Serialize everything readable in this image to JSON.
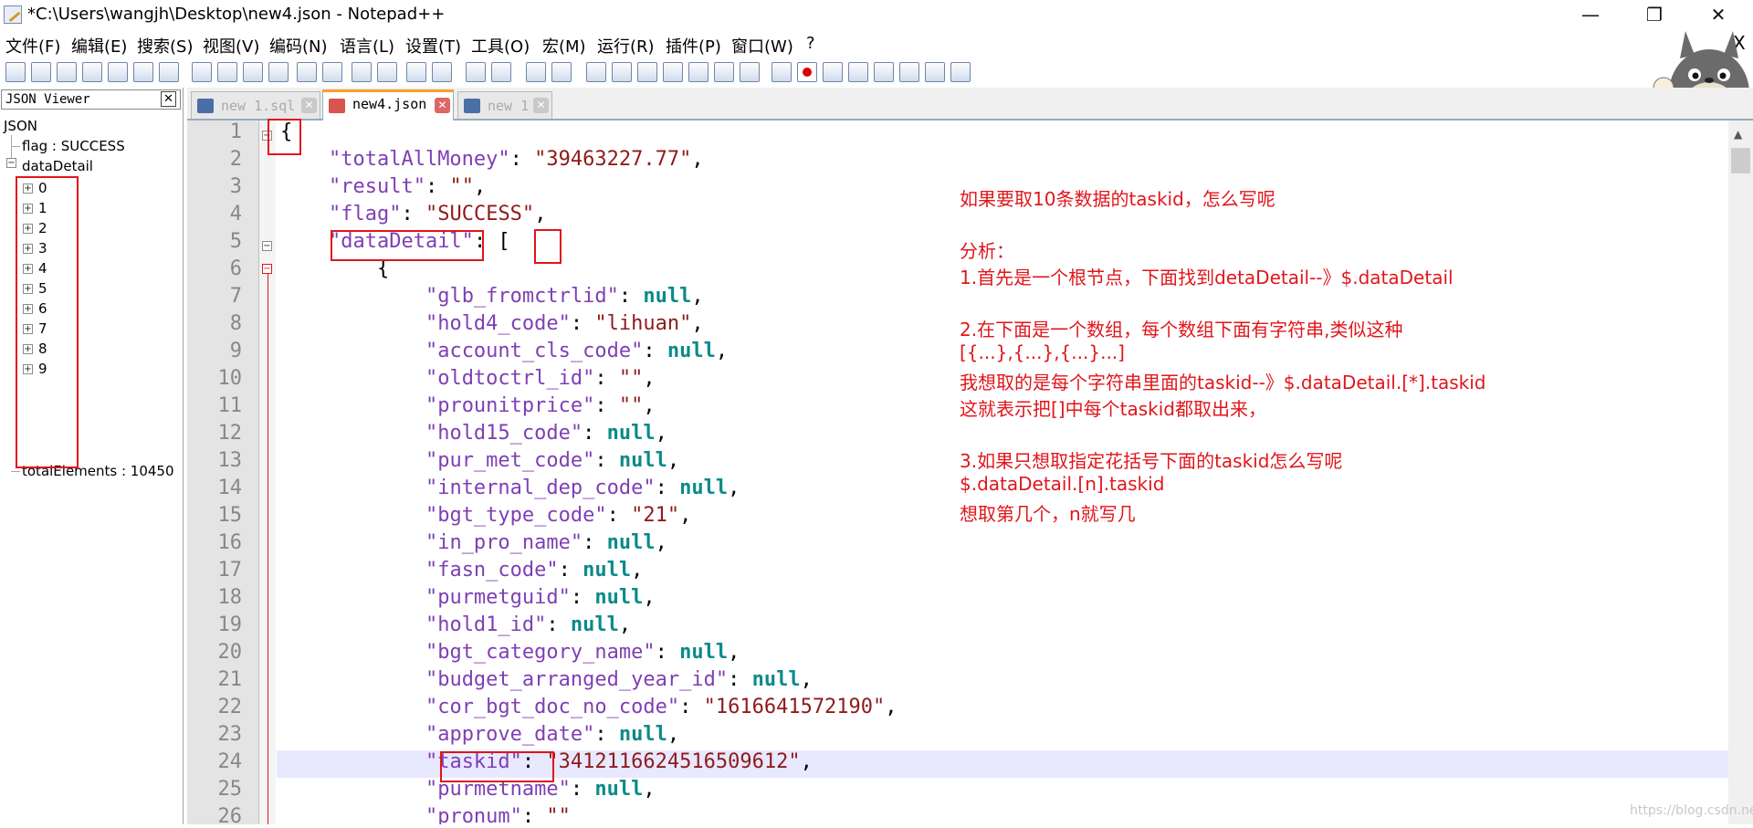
{
  "window": {
    "title": "*C:\\Users\\wangjh\\Desktop\\new4.json - Notepad++",
    "minimize": "—",
    "restore": "❐",
    "close": "✕"
  },
  "menu": {
    "items": [
      "文件(F)",
      "编辑(E)",
      "搜索(S)",
      "视图(V)",
      "编码(N)",
      "语言(L)",
      "设置(T)",
      "工具(O)",
      "宏(M)",
      "运行(R)",
      "插件(P)",
      "窗口(W)",
      "?"
    ],
    "close_doc": "X"
  },
  "panel": {
    "title": "JSON Viewer",
    "close": "✕",
    "root": "JSON",
    "flag": "flag : SUCCESS",
    "dataDetail": "dataDetail",
    "children": [
      "0",
      "1",
      "2",
      "3",
      "4",
      "5",
      "6",
      "7",
      "8",
      "9"
    ],
    "totalElements": "totalElements : 10450"
  },
  "tabs": [
    {
      "label": "new 1.sql",
      "active": false,
      "icon_color": "#4a6fa5"
    },
    {
      "label": "new4.json",
      "active": true,
      "icon_color": "#d9534f"
    },
    {
      "label": "new 1",
      "active": false,
      "icon_color": "#4a6fa5"
    }
  ],
  "editor": {
    "lines": [
      {
        "n": "1",
        "segs": [
          [
            "p",
            "{"
          ]
        ]
      },
      {
        "n": "2",
        "segs": [
          [
            "p",
            "    "
          ],
          [
            "k",
            "\"totalAllMoney\""
          ],
          [
            "p",
            ": "
          ],
          [
            "s",
            "\"39463227.77\""
          ],
          [
            "p",
            ","
          ]
        ]
      },
      {
        "n": "3",
        "segs": [
          [
            "p",
            "    "
          ],
          [
            "k",
            "\"result\""
          ],
          [
            "p",
            ": "
          ],
          [
            "s",
            "\"\""
          ],
          [
            "p",
            ","
          ]
        ]
      },
      {
        "n": "4",
        "segs": [
          [
            "p",
            "    "
          ],
          [
            "k",
            "\"flag\""
          ],
          [
            "p",
            ": "
          ],
          [
            "s",
            "\"SUCCESS\""
          ],
          [
            "p",
            ","
          ]
        ]
      },
      {
        "n": "5",
        "segs": [
          [
            "p",
            "    "
          ],
          [
            "k",
            "\"dataDetail\""
          ],
          [
            "p",
            ": ["
          ]
        ]
      },
      {
        "n": "6",
        "segs": [
          [
            "p",
            "        {"
          ]
        ]
      },
      {
        "n": "7",
        "segs": [
          [
            "p",
            "            "
          ],
          [
            "k",
            "\"glb_fromctrlid\""
          ],
          [
            "p",
            ": "
          ],
          [
            "n",
            "null"
          ],
          [
            "p",
            ","
          ]
        ]
      },
      {
        "n": "8",
        "segs": [
          [
            "p",
            "            "
          ],
          [
            "k",
            "\"hold4_code\""
          ],
          [
            "p",
            ": "
          ],
          [
            "s",
            "\"lihuan\""
          ],
          [
            "p",
            ","
          ]
        ]
      },
      {
        "n": "9",
        "segs": [
          [
            "p",
            "            "
          ],
          [
            "k",
            "\"account_cls_code\""
          ],
          [
            "p",
            ": "
          ],
          [
            "n",
            "null"
          ],
          [
            "p",
            ","
          ]
        ]
      },
      {
        "n": "10",
        "segs": [
          [
            "p",
            "            "
          ],
          [
            "k",
            "\"oldtoctrl_id\""
          ],
          [
            "p",
            ": "
          ],
          [
            "s",
            "\"\""
          ],
          [
            "p",
            ","
          ]
        ]
      },
      {
        "n": "11",
        "segs": [
          [
            "p",
            "            "
          ],
          [
            "k",
            "\"prounitprice\""
          ],
          [
            "p",
            ": "
          ],
          [
            "s",
            "\"\""
          ],
          [
            "p",
            ","
          ]
        ]
      },
      {
        "n": "12",
        "segs": [
          [
            "p",
            "            "
          ],
          [
            "k",
            "\"hold15_code\""
          ],
          [
            "p",
            ": "
          ],
          [
            "n",
            "null"
          ],
          [
            "p",
            ","
          ]
        ]
      },
      {
        "n": "13",
        "segs": [
          [
            "p",
            "            "
          ],
          [
            "k",
            "\"pur_met_code\""
          ],
          [
            "p",
            ": "
          ],
          [
            "n",
            "null"
          ],
          [
            "p",
            ","
          ]
        ]
      },
      {
        "n": "14",
        "segs": [
          [
            "p",
            "            "
          ],
          [
            "k",
            "\"internal_dep_code\""
          ],
          [
            "p",
            ": "
          ],
          [
            "n",
            "null"
          ],
          [
            "p",
            ","
          ]
        ]
      },
      {
        "n": "15",
        "segs": [
          [
            "p",
            "            "
          ],
          [
            "k",
            "\"bgt_type_code\""
          ],
          [
            "p",
            ": "
          ],
          [
            "s",
            "\"21\""
          ],
          [
            "p",
            ","
          ]
        ]
      },
      {
        "n": "16",
        "segs": [
          [
            "p",
            "            "
          ],
          [
            "k",
            "\"in_pro_name\""
          ],
          [
            "p",
            ": "
          ],
          [
            "n",
            "null"
          ],
          [
            "p",
            ","
          ]
        ]
      },
      {
        "n": "17",
        "segs": [
          [
            "p",
            "            "
          ],
          [
            "k",
            "\"fasn_code\""
          ],
          [
            "p",
            ": "
          ],
          [
            "n",
            "null"
          ],
          [
            "p",
            ","
          ]
        ]
      },
      {
        "n": "18",
        "segs": [
          [
            "p",
            "            "
          ],
          [
            "k",
            "\"purmetguid\""
          ],
          [
            "p",
            ": "
          ],
          [
            "n",
            "null"
          ],
          [
            "p",
            ","
          ]
        ]
      },
      {
        "n": "19",
        "segs": [
          [
            "p",
            "            "
          ],
          [
            "k",
            "\"hold1_id\""
          ],
          [
            "p",
            ": "
          ],
          [
            "n",
            "null"
          ],
          [
            "p",
            ","
          ]
        ]
      },
      {
        "n": "20",
        "segs": [
          [
            "p",
            "            "
          ],
          [
            "k",
            "\"bgt_category_name\""
          ],
          [
            "p",
            ": "
          ],
          [
            "n",
            "null"
          ],
          [
            "p",
            ","
          ]
        ]
      },
      {
        "n": "21",
        "segs": [
          [
            "p",
            "            "
          ],
          [
            "k",
            "\"budget_arranged_year_id\""
          ],
          [
            "p",
            ": "
          ],
          [
            "n",
            "null"
          ],
          [
            "p",
            ","
          ]
        ]
      },
      {
        "n": "22",
        "segs": [
          [
            "p",
            "            "
          ],
          [
            "k",
            "\"cor_bgt_doc_no_code\""
          ],
          [
            "p",
            ": "
          ],
          [
            "s",
            "\"1616641572190\""
          ],
          [
            "p",
            ","
          ]
        ]
      },
      {
        "n": "23",
        "segs": [
          [
            "p",
            "            "
          ],
          [
            "k",
            "\"approve_date\""
          ],
          [
            "p",
            ": "
          ],
          [
            "n",
            "null"
          ],
          [
            "p",
            ","
          ]
        ]
      },
      {
        "n": "24",
        "segs": [
          [
            "p",
            "            "
          ],
          [
            "k",
            "\"taskid\""
          ],
          [
            "p",
            ": "
          ],
          [
            "s",
            "\"3412116624516509612\""
          ],
          [
            "p",
            ","
          ]
        ]
      },
      {
        "n": "25",
        "segs": [
          [
            "p",
            "            "
          ],
          [
            "k",
            "\"purmetname\""
          ],
          [
            "p",
            ": "
          ],
          [
            "n",
            "null"
          ],
          [
            "p",
            ","
          ]
        ]
      },
      {
        "n": "26",
        "segs": [
          [
            "p",
            "            "
          ],
          [
            "k",
            "\"pronum\""
          ],
          [
            "p",
            ": "
          ],
          [
            "s",
            "\"\""
          ]
        ]
      }
    ],
    "current_line": "24"
  },
  "notes": [
    "如果要取10条数据的taskid，怎么写呢",
    "分析：",
    "1.首先是一个根节点，下面找到detaDetail--》$.dataDetail",
    "2.在下面是一个数组，每个数组下面有字符串,类似这种",
    "[{...},{...},{...}...]",
    "我想取的是每个字符串里面的taskid--》$.dataDetail.[*].taskid",
    "这就表示把[]中每个taskid都取出来，",
    "3.如果只想取指定花括号下面的taskid怎么写呢",
    "$.dataDetail.[n].taskid",
    "想取第几个，n就写几"
  ],
  "watermark": "https://blog.csdn.net/anyi_ViP",
  "colors": {
    "annotation_red": "#e0161b",
    "json_key": "#7e3fb5",
    "json_string": "#8e1b1b",
    "json_null": "#0d8a8a"
  }
}
